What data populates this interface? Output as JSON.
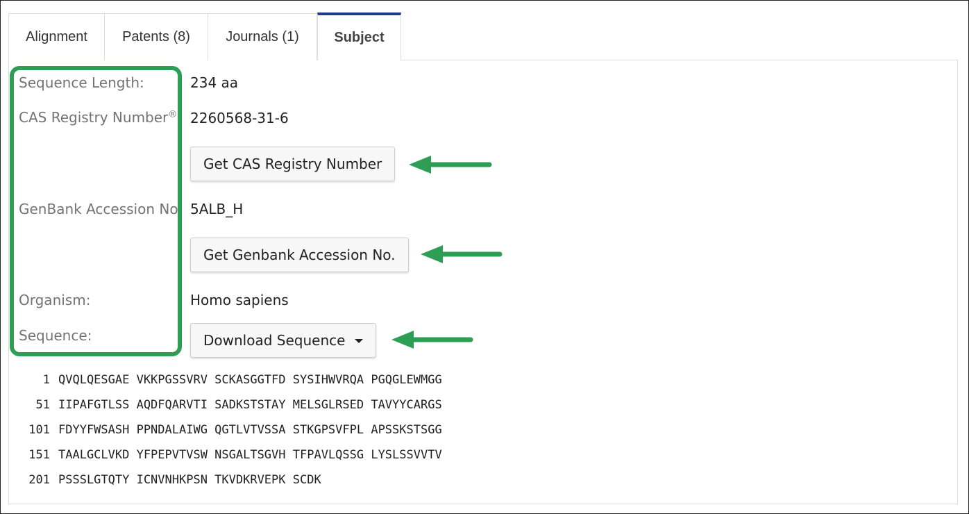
{
  "tabs": [
    {
      "label": "Alignment",
      "active": false
    },
    {
      "label": "Patents (8)",
      "active": false
    },
    {
      "label": "Journals (1)",
      "active": false
    },
    {
      "label": "Subject",
      "active": true
    }
  ],
  "fields": {
    "sequence_length": {
      "label": "Sequence Length:",
      "value": "234 aa"
    },
    "cas_registry": {
      "label": "CAS Registry Number",
      "label_sup": "®",
      "label_suffix": ":",
      "value": "2260568-31-6",
      "button": "Get CAS Registry Number"
    },
    "genbank": {
      "label": "GenBank Accession No.",
      "value": "5ALB_H",
      "button": "Get Genbank Accession No."
    },
    "organism": {
      "label": "Organism:",
      "value": "Homo sapiens"
    },
    "sequence": {
      "label": "Sequence:",
      "button": "Download Sequence"
    }
  },
  "sequence_lines": [
    {
      "num": "1",
      "text": "QVQLQESGAE VKKPGSSVRV SCKASGGTFD SYSIHWVRQA PGQGLEWMGG"
    },
    {
      "num": "51",
      "text": "IIPAFGTLSS AQDFQARVTI SADKSTSTAY MELSGLRSED TAVYYCARGS"
    },
    {
      "num": "101",
      "text": "FDYYFWSASH PPNDALAIWG QGTLVTVSSA STKGPSVFPL APSSKSTSGG"
    },
    {
      "num": "151",
      "text": "TAALGCLVKD YFPEPVTVSW NSGALTSGVH TFPAVLQSSG LYSLSSVVTV"
    },
    {
      "num": "201",
      "text": "PSSSLGTQTY ICNVNHKPSN TKVDKRVEPK SCDK"
    }
  ],
  "colors": {
    "accent_tab": "#1f3b8f",
    "annotation": "#2e9e55"
  }
}
